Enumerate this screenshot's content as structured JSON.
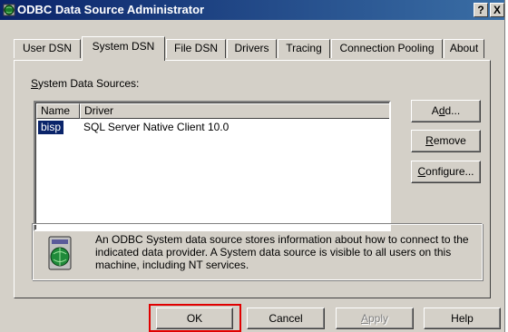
{
  "window": {
    "title": "ODBC Data Source Administrator",
    "help_glyph": "?",
    "close_glyph": "X"
  },
  "tabs": [
    {
      "label": "User DSN",
      "active": false
    },
    {
      "label": "System DSN",
      "active": true
    },
    {
      "label": "File DSN",
      "active": false
    },
    {
      "label": "Drivers",
      "active": false
    },
    {
      "label": "Tracing",
      "active": false
    },
    {
      "label": "Connection Pooling",
      "active": false
    },
    {
      "label": "About",
      "active": false
    }
  ],
  "panel": {
    "list_label_first": "S",
    "list_label_rest": "ystem Data Sources:",
    "columns": [
      "Name",
      "Driver"
    ],
    "rows": [
      {
        "name": "bisp",
        "driver": "SQL Server Native Client 10.0",
        "selected": true
      }
    ],
    "buttons": {
      "add_pre": "A",
      "add_u": "d",
      "add_post": "d...",
      "remove_u": "R",
      "remove_post": "emove",
      "configure_u": "C",
      "configure_post": "onfigure..."
    },
    "info_text": "An ODBC System data source stores information about how to connect to the indicated data provider.   A System data source is visible to all users on this machine, including NT services."
  },
  "footer": {
    "ok": "OK",
    "cancel": "Cancel",
    "apply_u": "A",
    "apply_post": "pply",
    "help": "Help"
  },
  "colors": {
    "titlebar_start": "#0a246a",
    "titlebar_end": "#3a6ea5",
    "face": "#d4d0c8",
    "selection": "#0a246a",
    "highlight_box": "#e00000"
  },
  "icons": {
    "app": "odbc-globe-icon",
    "info": "server-globe-icon"
  }
}
